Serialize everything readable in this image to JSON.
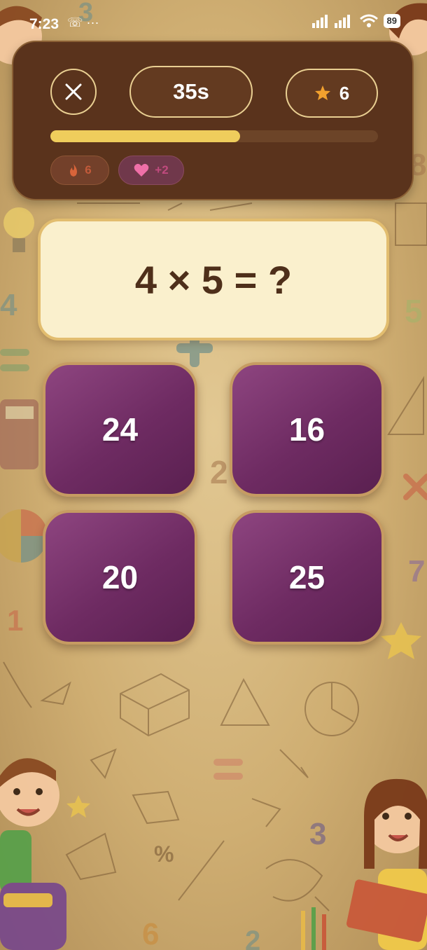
{
  "status_bar": {
    "time": "7:23",
    "app_icons": "☏ ···",
    "battery": "89"
  },
  "header": {
    "timer": "35s",
    "stars": "6",
    "progress": 0.58,
    "streak": "6",
    "lives": "+2"
  },
  "question": {
    "text": "4 × 5 = ?"
  },
  "answers": [
    "24",
    "16",
    "20",
    "25"
  ],
  "colors": {
    "panel": "#5a331c",
    "progress_fill": "#efcd5c",
    "card": "#faf0cd",
    "answer_tile": "#7a3370",
    "text_dark": "#4e2f1a"
  }
}
